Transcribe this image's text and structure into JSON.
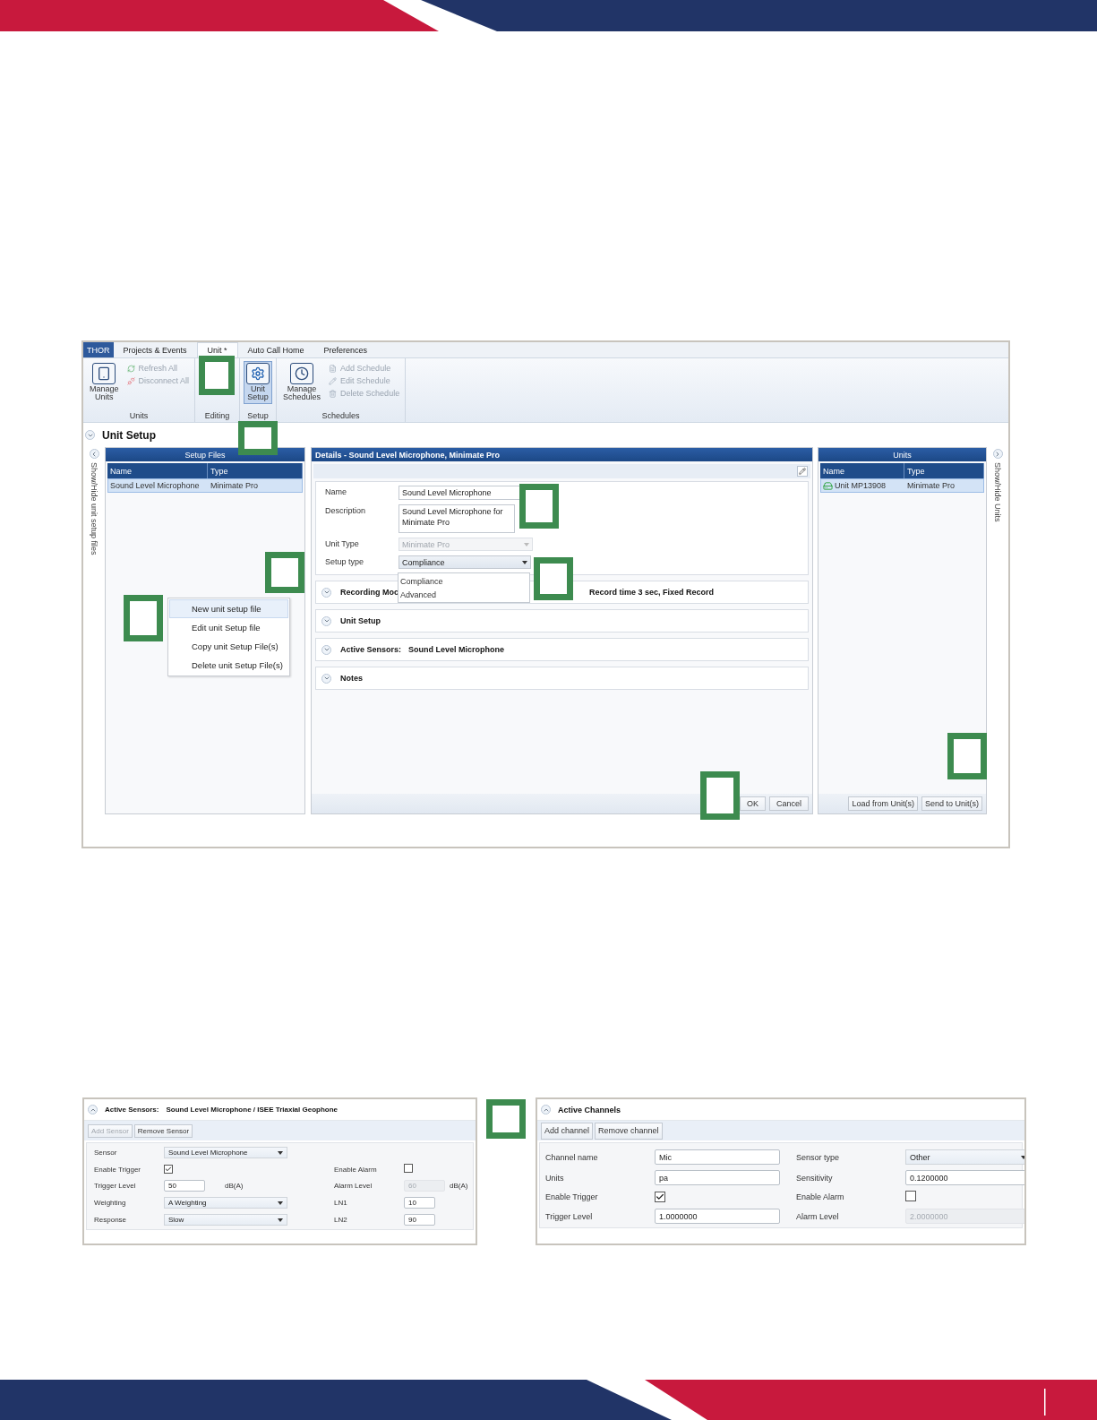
{
  "app": {
    "tabs": [
      {
        "label": "THOR",
        "kind": "app",
        "selected": false
      },
      {
        "label": "Projects & Events",
        "kind": "tab",
        "selected": false
      },
      {
        "label": "Unit *",
        "kind": "tab",
        "selected": true
      },
      {
        "label": "Auto Call Home",
        "kind": "tab",
        "selected": false
      },
      {
        "label": "Preferences",
        "kind": "tab",
        "selected": false
      }
    ],
    "ribbon": [
      {
        "label": "Units",
        "items": [
          {
            "label": "Manage Units",
            "kind": "large",
            "disabled": false,
            "selected": false
          },
          {
            "label": "Refresh All",
            "kind": "small",
            "disabled": true
          },
          {
            "label": "Disconnect All",
            "kind": "small",
            "disabled": true
          }
        ]
      },
      {
        "label": "Editing"
      },
      {
        "label": "Setup",
        "items": [
          {
            "label": "Unit Setup",
            "kind": "large",
            "disabled": false,
            "selected": true
          }
        ]
      },
      {
        "label": "Schedules",
        "items": [
          {
            "label": "Manage Schedules",
            "kind": "large",
            "disabled": false,
            "selected": false
          },
          {
            "label": "Add Schedule",
            "kind": "small",
            "disabled": true
          },
          {
            "label": "Edit Schedule",
            "kind": "small",
            "disabled": true
          },
          {
            "label": "Delete Schedule",
            "kind": "small",
            "disabled": true
          }
        ]
      }
    ],
    "section_title": "Unit Setup",
    "left_toggle": "Show/Hide unit setup files",
    "setup_files": {
      "title": "Setup Files",
      "columns": [
        "Name",
        "Type"
      ],
      "rows": [
        {
          "cells": [
            "Sound Level Microphone",
            "Minimate Pro"
          ],
          "selected": true
        }
      ]
    },
    "context_menu": [
      {
        "label": "New unit setup file",
        "selected": true
      },
      {
        "label": "Edit unit Setup file",
        "selected": false
      },
      {
        "label": "Copy unit Setup File(s)",
        "selected": false
      },
      {
        "label": "Delete unit Setup File(s)",
        "selected": false
      }
    ],
    "details": {
      "title": "Details - Sound Level Microphone, Minimate Pro",
      "fields": [
        {
          "label": "Name",
          "kind": "input",
          "value": "Sound Level Microphone",
          "disabled": false
        },
        {
          "label": "Description",
          "kind": "textarea",
          "value": "Sound Level Microphone for Minimate Pro",
          "disabled": false
        },
        {
          "label": "Unit Type",
          "kind": "select",
          "value": "Minimate Pro",
          "disabled": true,
          "expanded": false
        },
        {
          "label": "Setup type",
          "kind": "select",
          "value": "Compliance",
          "disabled": false,
          "expanded": true
        }
      ],
      "dropdown_options": [
        "Compliance",
        "Advanced"
      ],
      "sections": [
        {
          "title": "Recording Moc",
          "summary": "Record time 3 sec, Fixed Record",
          "expanded": false
        },
        {
          "title": "Unit Setup",
          "expanded": false
        },
        {
          "title": "Active Sensors:",
          "summary": "Sound Level Microphone",
          "expanded": false
        },
        {
          "title": "Notes",
          "expanded": false
        }
      ],
      "buttons": [
        "OK",
        "Cancel"
      ]
    },
    "units": {
      "title": "Units",
      "columns": [
        "Name",
        "Type"
      ],
      "rows": [
        {
          "cells": [
            "Unit MP13908",
            "Minimate Pro"
          ],
          "selected": true
        }
      ],
      "buttons": [
        "Load from Unit(s)",
        "Send to Unit(s)"
      ]
    },
    "right_toggle": "Show/Hide Units"
  },
  "sensors_panel": {
    "title": "Active Sensors:",
    "summary": "Sound Level Microphone / ISEE Triaxial Geophone",
    "expanded": true,
    "buttons": [
      {
        "label": "Add Sensor",
        "disabled": true
      },
      {
        "label": "Remove Sensor",
        "disabled": false
      }
    ],
    "rows": [
      [
        {
          "label": "Sensor",
          "kind": "select",
          "value": "Sound Level Microphone",
          "disabled": false
        }
      ],
      [
        {
          "label": "Enable Trigger",
          "kind": "check",
          "checked": true
        },
        {
          "label": "Enable Alarm",
          "kind": "check",
          "checked": false
        }
      ],
      [
        {
          "label": "Trigger Level",
          "kind": "input",
          "value": "50",
          "unit": "dB(A)",
          "disabled": false
        },
        {
          "label": "Alarm Level",
          "kind": "input",
          "value": "60",
          "unit": "dB(A)",
          "disabled": true
        }
      ],
      [
        {
          "label": "Weighting",
          "kind": "select",
          "value": "A Weighting",
          "disabled": false
        },
        {
          "label": "LN1",
          "kind": "input",
          "value": "10",
          "disabled": false
        }
      ],
      [
        {
          "label": "Response",
          "kind": "select",
          "value": "Slow",
          "disabled": false
        },
        {
          "label": "LN2",
          "kind": "input",
          "value": "90",
          "disabled": false
        }
      ]
    ]
  },
  "channels_panel": {
    "title": "Active Channels",
    "expanded": true,
    "buttons": [
      {
        "label": "Add channel",
        "disabled": false
      },
      {
        "label": "Remove channel",
        "disabled": false
      }
    ],
    "rows": [
      [
        {
          "label": "Channel name",
          "kind": "input",
          "value": "Mic",
          "disabled": false
        },
        {
          "label": "Sensor type",
          "kind": "select",
          "value": "Other",
          "disabled": false
        }
      ],
      [
        {
          "label": "Units",
          "kind": "input",
          "value": "pa",
          "disabled": false
        },
        {
          "label": "Sensitivity",
          "kind": "input",
          "value": "0.1200000",
          "disabled": false
        }
      ],
      [
        {
          "label": "Enable Trigger",
          "kind": "check",
          "checked": true
        },
        {
          "label": "Enable Alarm",
          "kind": "check",
          "checked": false
        }
      ],
      [
        {
          "label": "Trigger Level",
          "kind": "input",
          "value": "1.0000000",
          "disabled": false
        },
        {
          "label": "Alarm Level",
          "kind": "input",
          "value": "2.0000000",
          "disabled": true
        }
      ]
    ]
  }
}
